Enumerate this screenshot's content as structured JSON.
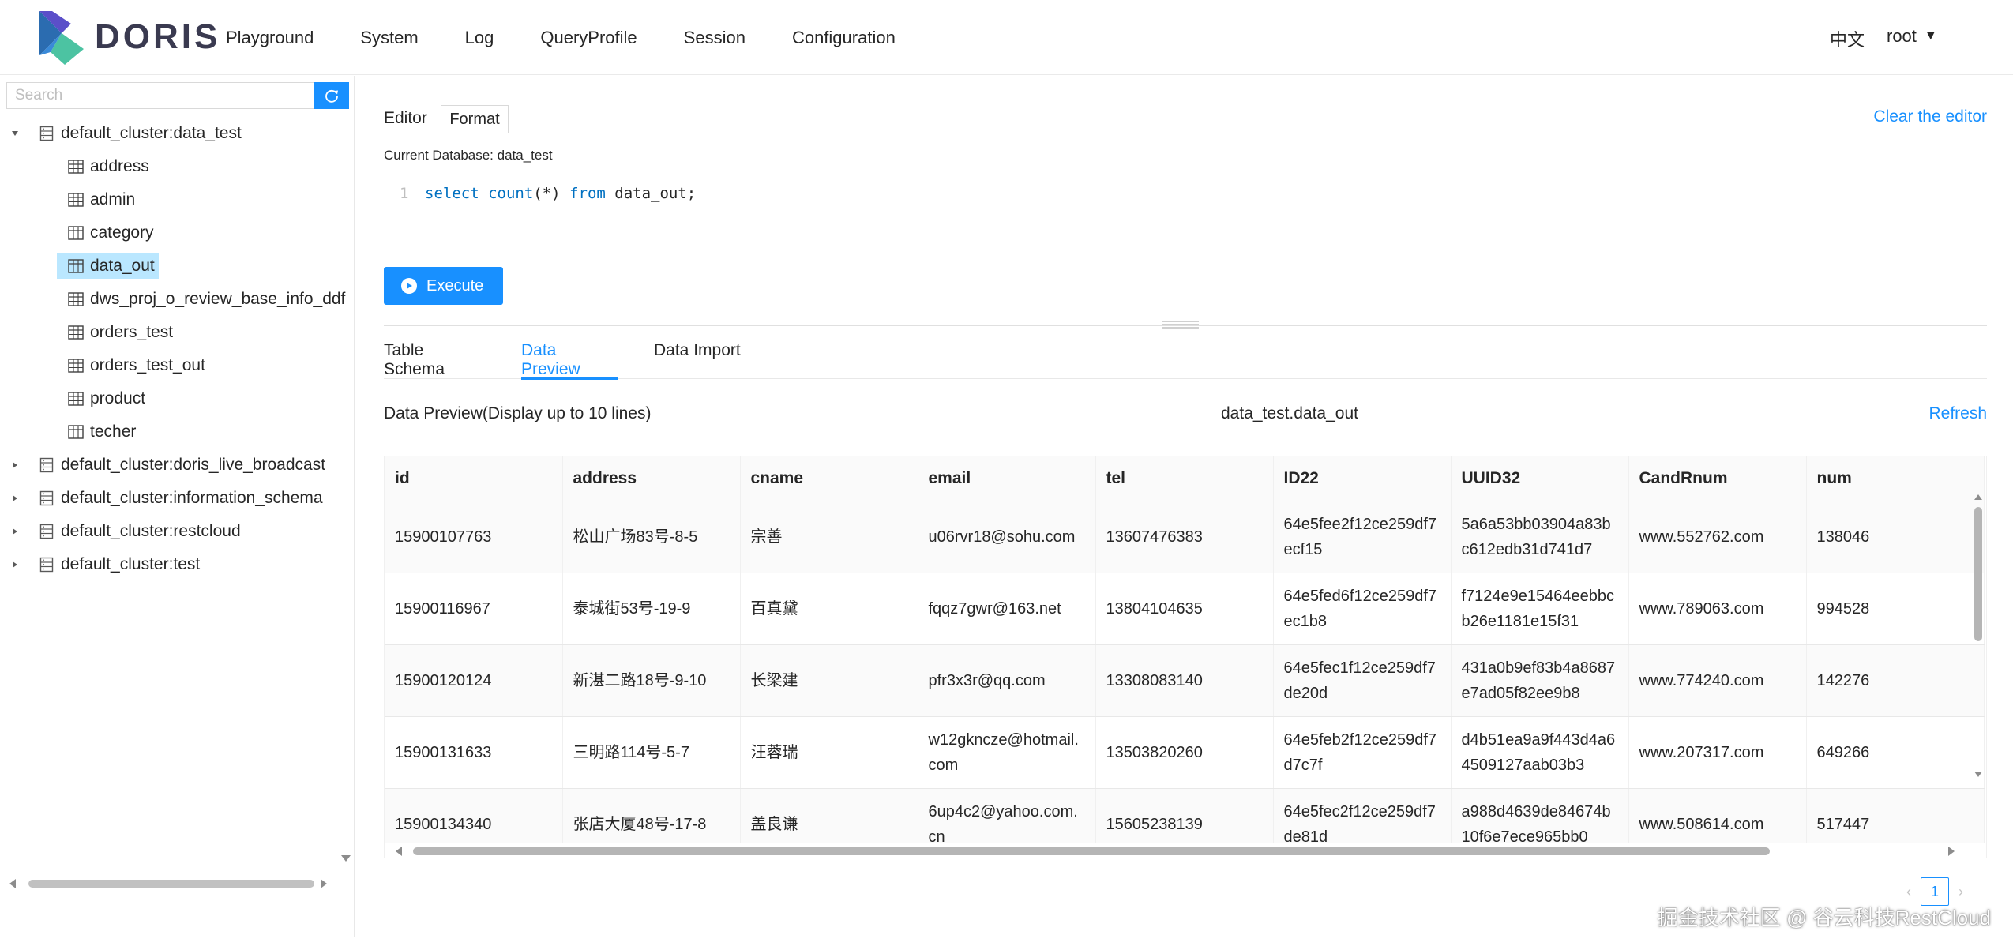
{
  "brand": {
    "name": "DORIS"
  },
  "nav": {
    "items": [
      "Playground",
      "System",
      "Log",
      "QueryProfile",
      "Session",
      "Configuration"
    ]
  },
  "header": {
    "language": "中文",
    "user": "root"
  },
  "sidebar": {
    "search_placeholder": "Search",
    "tree": [
      {
        "type": "db",
        "label": "default_cluster:data_test",
        "expanded": true
      },
      {
        "type": "table",
        "label": "address"
      },
      {
        "type": "table",
        "label": "admin"
      },
      {
        "type": "table",
        "label": "category"
      },
      {
        "type": "table",
        "label": "data_out",
        "selected": true
      },
      {
        "type": "table",
        "label": "dws_proj_o_review_base_info_ddf"
      },
      {
        "type": "table",
        "label": "orders_test"
      },
      {
        "type": "table",
        "label": "orders_test_out"
      },
      {
        "type": "table",
        "label": "product"
      },
      {
        "type": "table",
        "label": "techer"
      },
      {
        "type": "db",
        "label": "default_cluster:doris_live_broadcast",
        "expanded": false
      },
      {
        "type": "db",
        "label": "default_cluster:information_schema",
        "expanded": false
      },
      {
        "type": "db",
        "label": "default_cluster:restcloud",
        "expanded": false
      },
      {
        "type": "db",
        "label": "default_cluster:test",
        "expanded": false
      }
    ]
  },
  "editor": {
    "label": "Editor",
    "format_label": "Format",
    "clear_label": "Clear the editor",
    "current_db": "Current Database: data_test",
    "line_number": "1",
    "code_tokens": [
      {
        "t": "select",
        "k": true
      },
      {
        "t": " ",
        "k": false
      },
      {
        "t": "count",
        "k": true
      },
      {
        "t": "(*) ",
        "k": false
      },
      {
        "t": "from",
        "k": true
      },
      {
        "t": " data_out;",
        "k": false
      }
    ],
    "execute_label": "Execute"
  },
  "tabs": [
    {
      "label": "Table Schema",
      "active": false
    },
    {
      "label": "Data Preview",
      "active": true
    },
    {
      "label": "Data Import",
      "active": false
    }
  ],
  "preview": {
    "title": "Data Preview(Display up to 10 lines)",
    "table_name": "data_test.data_out",
    "refresh_label": "Refresh",
    "columns": [
      "id",
      "address",
      "cname",
      "email",
      "tel",
      "ID22",
      "UUID32",
      "CandRnum",
      "num"
    ],
    "rows": [
      [
        "15900107763",
        "松山广场83号-8-5",
        "宗善",
        "u06rvr18@sohu.com",
        "13607476383",
        "64e5fee2f12ce259df7ecf15",
        "5a6a53bb03904a83bc612edb31d741d7",
        "www.552762.com",
        "138046"
      ],
      [
        "15900116967",
        "泰城街53号-19-9",
        "百真黛",
        "fqqz7gwr@163.net",
        "13804104635",
        "64e5fed6f12ce259df7ec1b8",
        "f7124e9e15464eebbcb26e1181e15f31",
        "www.789063.com",
        "994528"
      ],
      [
        "15900120124",
        "新湛二路18号-9-10",
        "长梁建",
        "pfr3x3r@qq.com",
        "13308083140",
        "64e5fec1f12ce259df7de20d",
        "431a0b9ef83b4a8687e7ad05f82ee9b8",
        "www.774240.com",
        "142276"
      ],
      [
        "15900131633",
        "三明路114号-5-7",
        "汪蓉瑞",
        "w12gkncze@hotmail.com",
        "13503820260",
        "64e5feb2f12ce259df7d7c7f",
        "d4b51ea9a9f443d4a64509127aab03b3",
        "www.207317.com",
        "649266"
      ],
      [
        "15900134340",
        "张店大厦48号-17-8",
        "盖良谦",
        "6up4c2@yahoo.com.cn",
        "15605238139",
        "64e5fec2f12ce259df7de81d",
        "a988d4639de84674b10f6e7ece965bb0",
        "www.508614.com",
        "517447"
      ]
    ]
  },
  "pagination": {
    "current": "1"
  },
  "watermark": "掘金技术社区 @ 谷云科技RestCloud"
}
